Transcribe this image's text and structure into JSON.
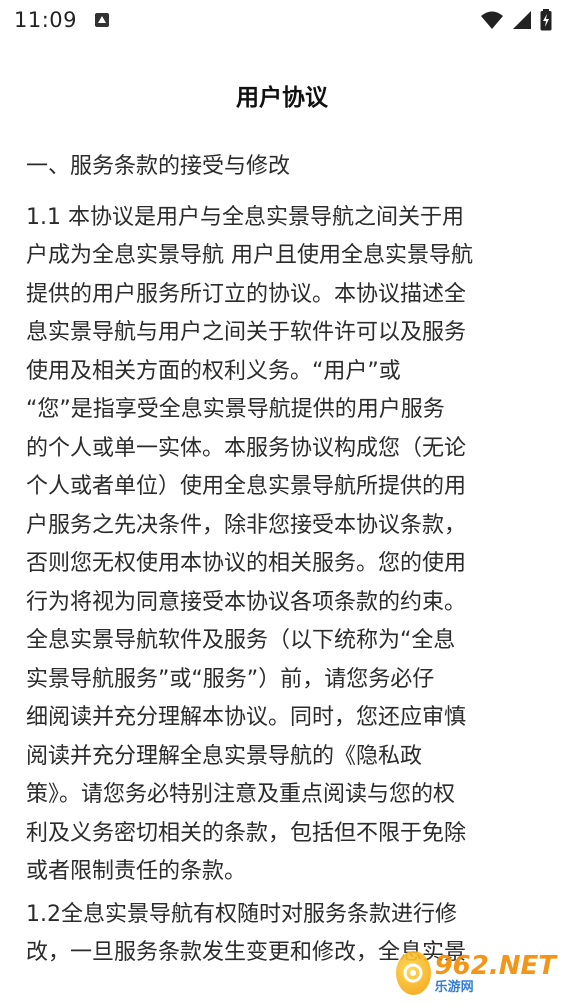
{
  "status_bar": {
    "time": "11:09",
    "icons": [
      "notification-icon",
      "wifi-icon",
      "cellular-signal-icon",
      "battery-charging-icon"
    ]
  },
  "page": {
    "title": "用户协议"
  },
  "agreement": {
    "section_1_heading": "一、服务条款的接受与修改",
    "para_1_1_lines": [
      "1.1 本协议是用户与全息实景导航之间关于用",
      "户成为全息实景导航 用户且使用全息实景导航",
      "提供的用户服务所订立的协议。本协议描述全",
      "息实景导航与用户之间关于软件许可以及服务",
      "使用及相关方面的权利义务。“用户”或",
      "“您”是指享受全息实景导航提供的用户服务",
      "的个人或单一实体。本服务协议构成您（无论",
      "个人或者单位）使用全息实景导航所提供的用",
      "户服务之先决条件，除非您接受本协议条款，",
      "否则您无权使用本协议的相关服务。您的使用",
      "行为将视为同意接受本协议各项条款的约束。",
      "全息实景导航软件及服务（以下统称为“全息",
      "实景导航服务”或“服务”）前，请您务必仔",
      "细阅读并充分理解本协议。同时，您还应审慎",
      "阅读并充分理解全息实景导航的《隐私政",
      "策》。请您务必特别注意及重点阅读与您的权",
      "利及义务密切相关的条款，包括但不限于免除",
      "或者限制责任的条款。"
    ],
    "para_1_2_lines": [
      "1.2全息实景导航有权随时对服务条款进行修",
      "改，一旦服务条款发生变更和修改，全息实景"
    ]
  },
  "watermark": {
    "main": "962.NET",
    "sub": "乐游网"
  }
}
